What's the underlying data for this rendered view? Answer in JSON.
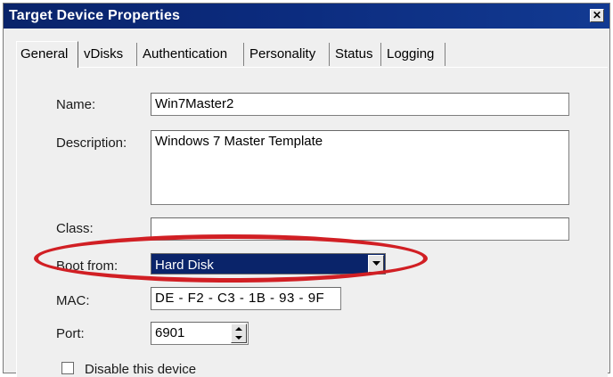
{
  "window": {
    "title": "Target Device Properties",
    "close_label": "✕"
  },
  "tabs": [
    {
      "label": "General",
      "active": true
    },
    {
      "label": "vDisks"
    },
    {
      "label": "Authentication"
    },
    {
      "label": "Personality"
    },
    {
      "label": "Status"
    },
    {
      "label": "Logging"
    }
  ],
  "form": {
    "name_label": "Name:",
    "name_value": "Win7Master2",
    "description_label": "Description:",
    "description_value": "Windows 7 Master Template",
    "class_label": "Class:",
    "class_value": "",
    "boot_label": "Boot from:",
    "boot_value": "Hard Disk",
    "mac_label": "MAC:",
    "mac_value": "DE - F2 - C3 - 1B - 93 - 9F",
    "port_label": "Port:",
    "port_value": "6901",
    "disable_label": "Disable this device",
    "disable_checked": false
  },
  "colors": {
    "titlebar": "#0a246a",
    "highlight_ellipse": "#d11f24",
    "selected_bg": "#0a246a"
  },
  "icons": {
    "dropdown": "chevron-down-icon",
    "spinner_up": "arrow-up-icon",
    "spinner_down": "arrow-down-icon"
  }
}
